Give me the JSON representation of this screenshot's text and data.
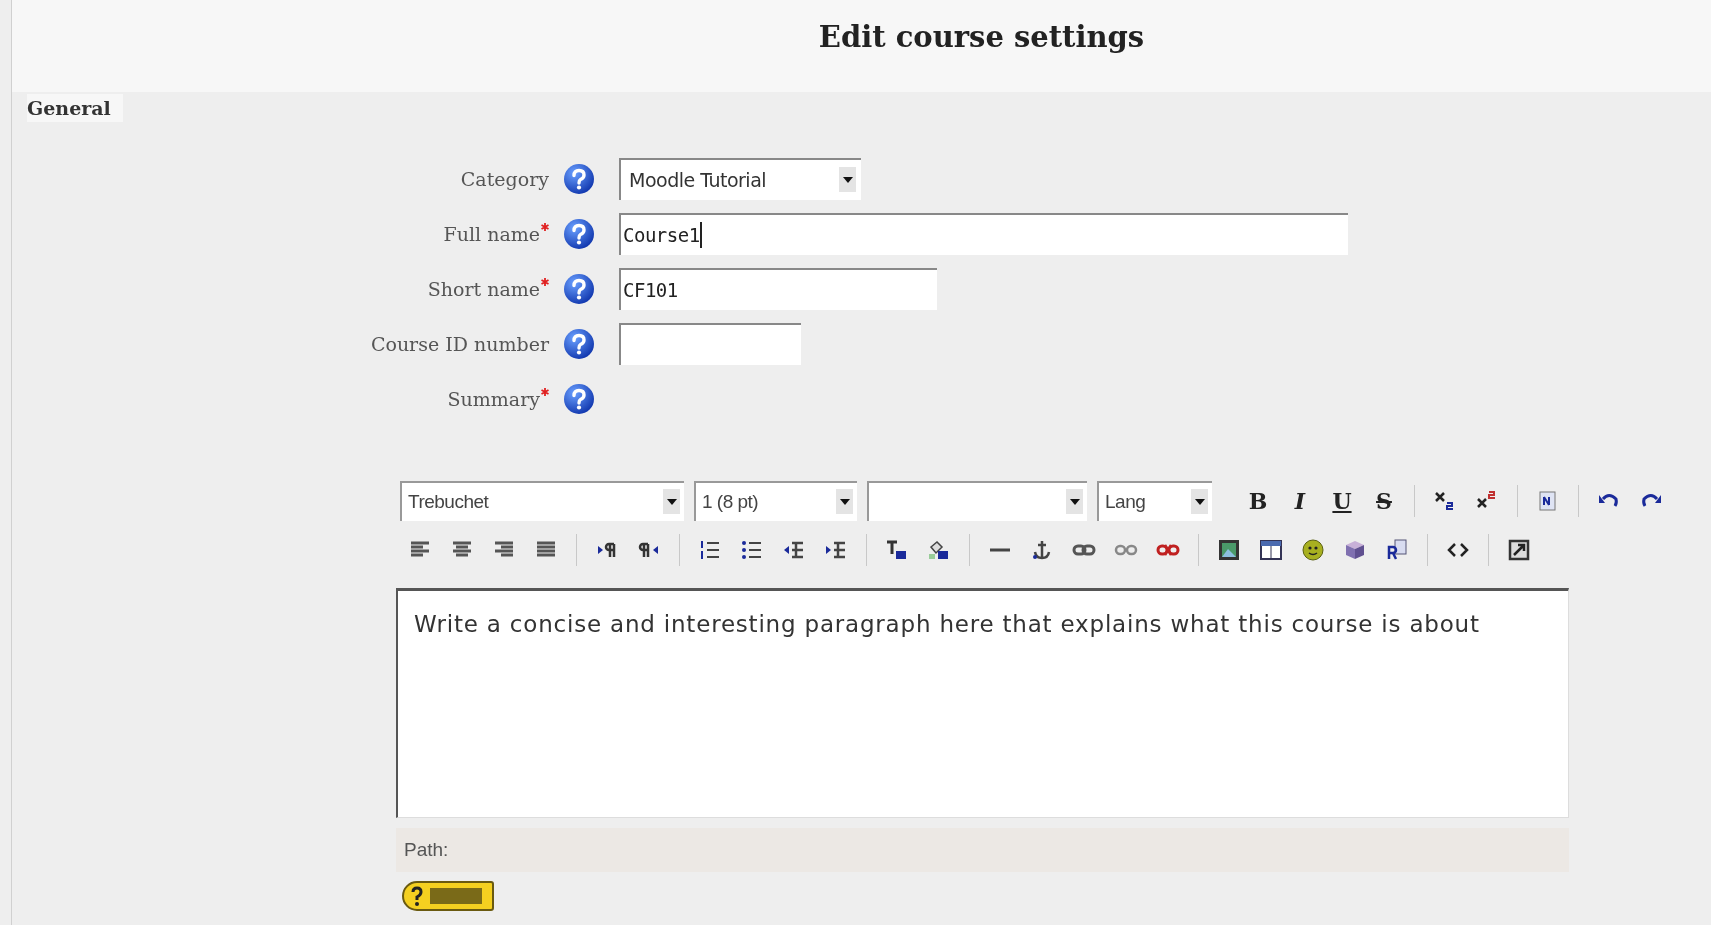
{
  "page": {
    "title": "Edit course settings"
  },
  "section": {
    "title": "General"
  },
  "fields": [
    {
      "label": "Category",
      "required": false,
      "kind": "select",
      "value": "Moodle Tutorial"
    },
    {
      "label": "Full name",
      "required": true,
      "kind": "text",
      "value": "Course1",
      "focused": true
    },
    {
      "label": "Short name",
      "required": true,
      "kind": "text",
      "value": "CF101"
    },
    {
      "label": "Course ID number",
      "required": false,
      "kind": "text"
    },
    {
      "label": "Summary",
      "required": true,
      "kind": "editor"
    }
  ],
  "editor": {
    "selects": [
      {
        "kind": "font",
        "value": "Trebuchet"
      },
      {
        "kind": "size",
        "value": "1 (8 pt)"
      },
      {
        "kind": "format"
      },
      {
        "kind": "lang",
        "value": "Lang"
      }
    ],
    "style_buttons": [
      "B",
      "I",
      "U",
      "S"
    ],
    "content": "Write a concise and interesting paragraph here that explains what this course is about",
    "path_label": "Path:"
  }
}
